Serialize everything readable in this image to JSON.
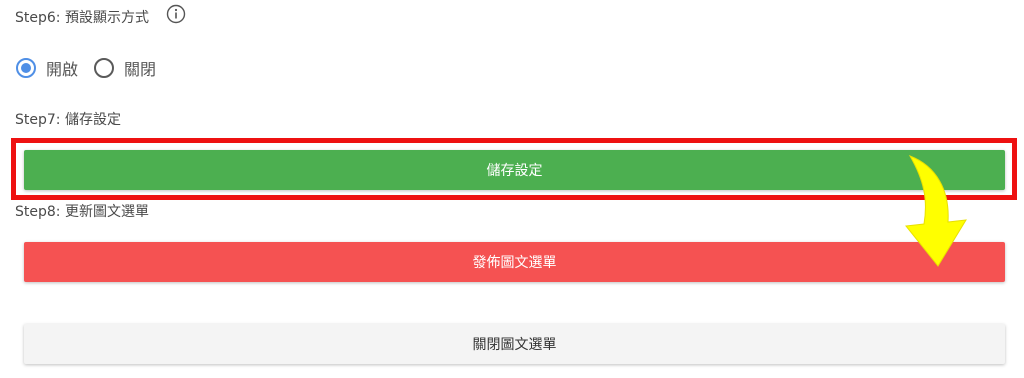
{
  "step6": {
    "label": "Step6: 預設顯示方式",
    "info_icon": "info-icon"
  },
  "radio": {
    "options": [
      {
        "label": "開啟",
        "checked": true
      },
      {
        "label": "關閉",
        "checked": false
      }
    ],
    "accent_color": "#4f8fe6"
  },
  "step7": {
    "label": "Step7: 儲存設定",
    "save_button": "儲存設定"
  },
  "step8": {
    "label": "Step8: 更新圖文選單",
    "publish_button": "發佈圖文選單",
    "close_button": "關閉圖文選單"
  },
  "colors": {
    "save": "#4caf50",
    "publish": "#f55252",
    "close": "#f4f4f4",
    "highlight": "#ee1111",
    "arrow": "#ffff00"
  },
  "annotation_icon": "curved-arrow-icon"
}
